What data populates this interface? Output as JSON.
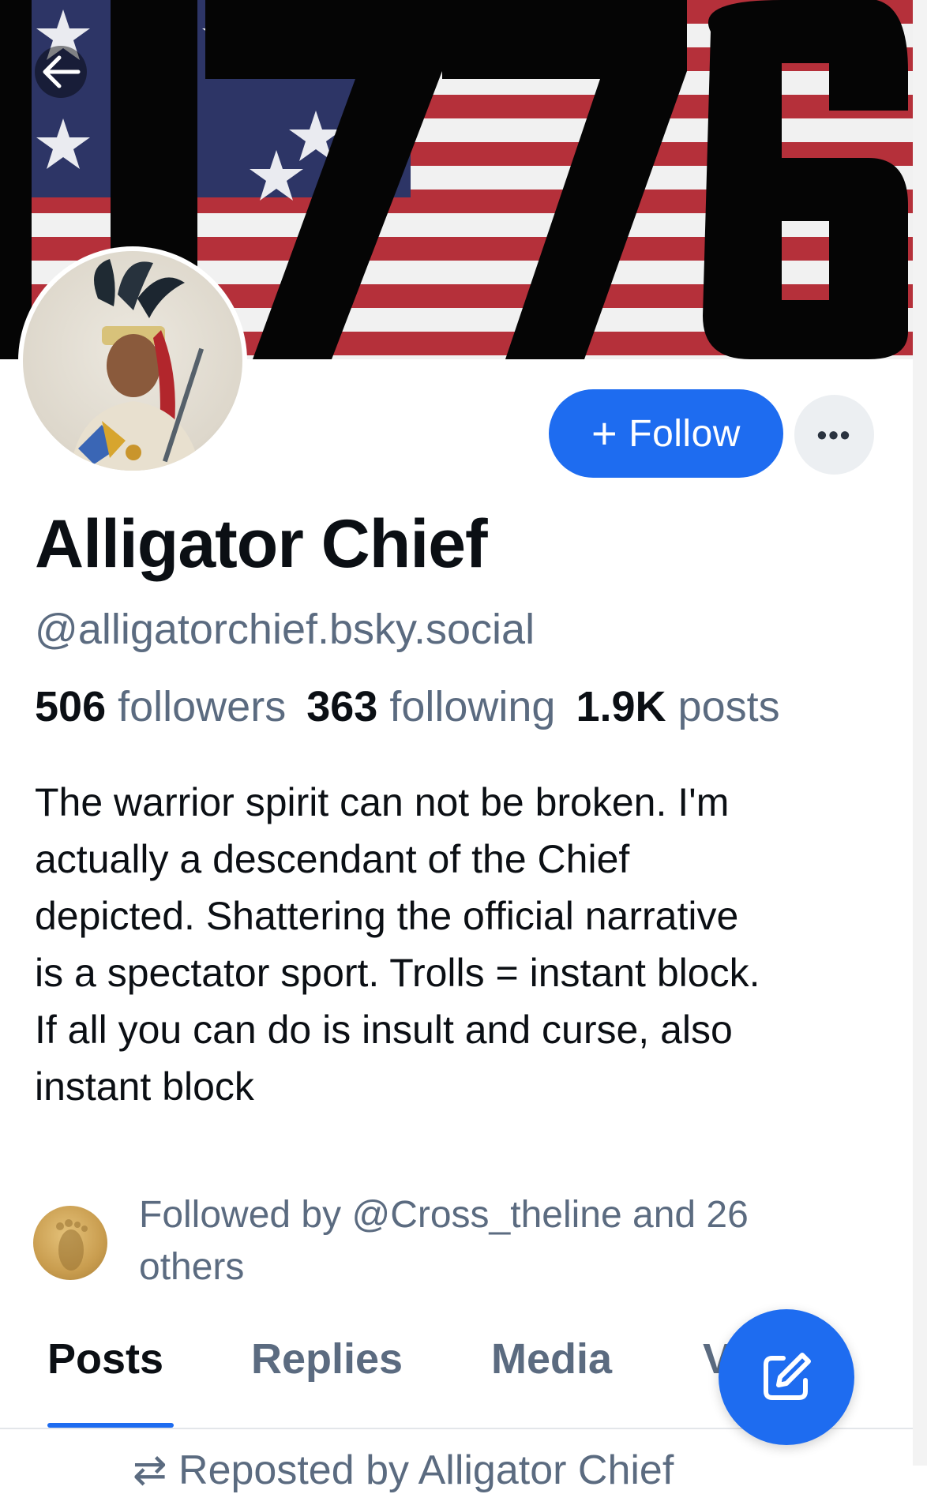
{
  "banner": {
    "text": "1776"
  },
  "profile": {
    "display_name": "Alligator Chief",
    "handle": "@alligatorchief.bsky.social",
    "follow_label": "Follow",
    "more_label": "•••"
  },
  "stats": {
    "followers_count": "506",
    "followers_label": "followers",
    "following_count": "363",
    "following_label": "following",
    "posts_count": "1.9K",
    "posts_label": "posts"
  },
  "bio": {
    "lines": [
      "The warrior spirit can not be broken. I'm",
      "actually a descendant of the Chief",
      "depicted. Shattering the official narrative",
      "is a spectator sport. Trolls = instant block.",
      "If all you can do is insult and curse, also",
      "instant block"
    ]
  },
  "followed_by": {
    "lines": [
      "Followed by @Cross_theline and 26",
      "others"
    ]
  },
  "tabs": [
    {
      "label": "Posts"
    },
    {
      "label": "Replies"
    },
    {
      "label": "Media"
    },
    {
      "label": "Videos"
    }
  ],
  "feed": {
    "first_item_header": "Reposted by Alligator Chief"
  },
  "colors": {
    "accent": "#1e6cf0",
    "muted": "#5b6b80",
    "text": "#0b0f14"
  },
  "icons": {
    "back": "arrow-left-icon",
    "compose": "compose-icon",
    "repost": "repost-icon"
  }
}
